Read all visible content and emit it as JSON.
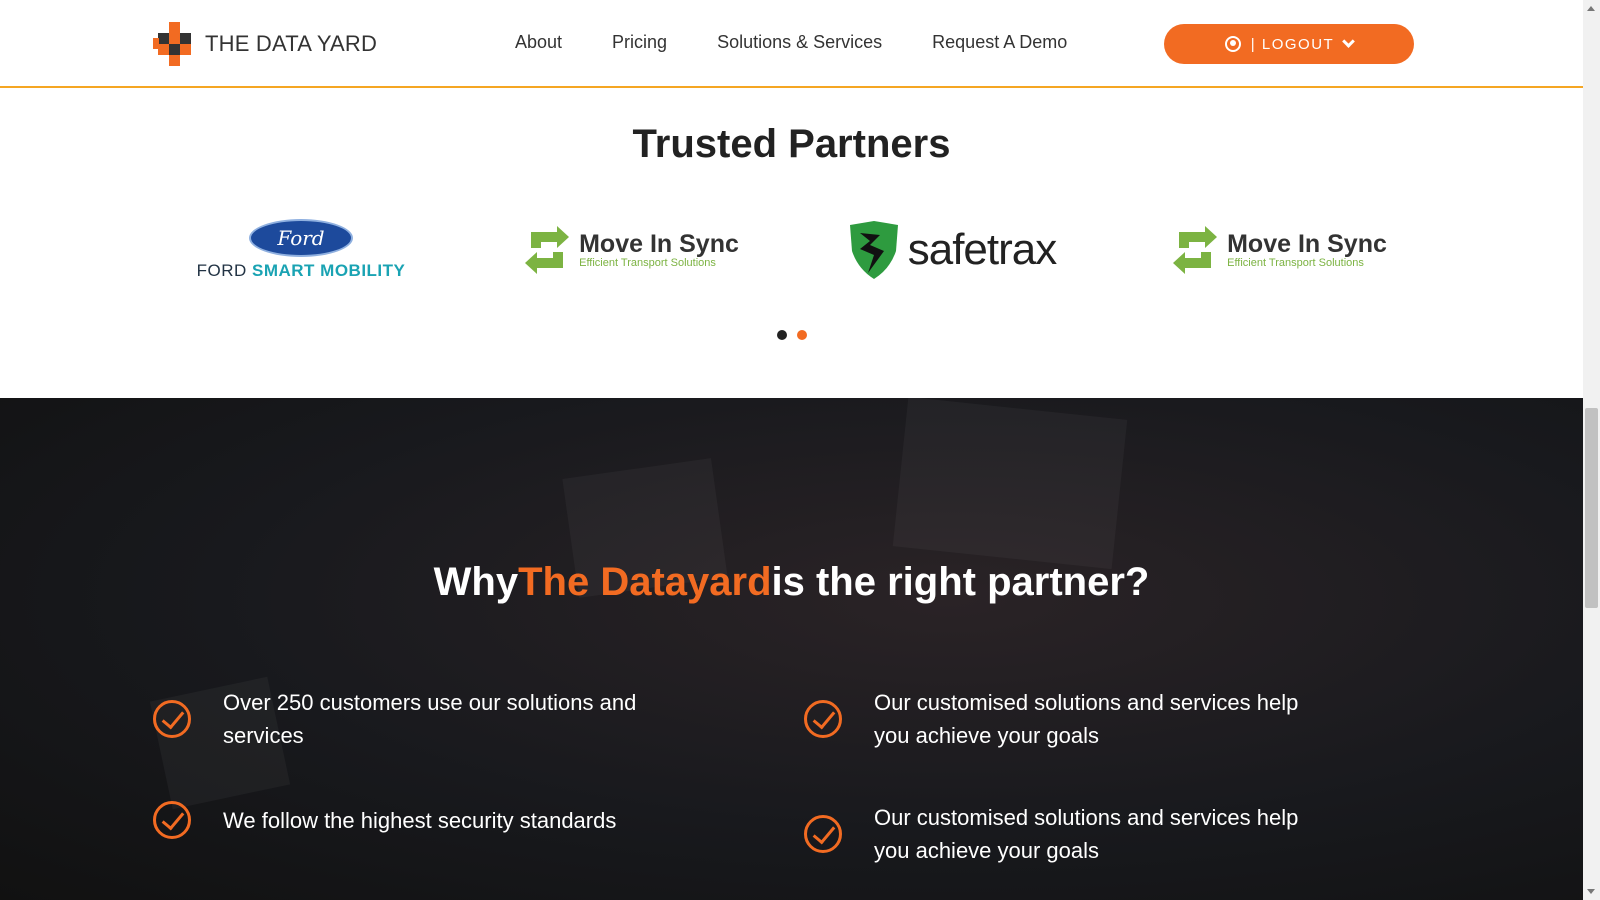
{
  "header": {
    "logo_text": "THE DATA YARD",
    "nav": [
      {
        "label": "About"
      },
      {
        "label": "Pricing"
      },
      {
        "label": "Solutions & Services"
      },
      {
        "label": "Request A Demo"
      }
    ],
    "logout_label": "| LOGOUT"
  },
  "partners": {
    "title": "Trusted Partners",
    "items": [
      {
        "name": "Ford",
        "sub_light": "FORD",
        "sub_bold": "SMART MOBILITY"
      },
      {
        "name": "Move In Sync",
        "tagline": "Efficient Transport Solutions"
      },
      {
        "name": "safetrax"
      },
      {
        "name": "Move In Sync",
        "tagline": "Efficient Transport Solutions"
      }
    ],
    "carousel_active_index": 1
  },
  "why": {
    "title_pre": "Why",
    "title_accent": "The Datayard",
    "title_post": "is the right partner?",
    "features": [
      {
        "text": "Over 250 customers use our solutions and services"
      },
      {
        "text": "Our customised solutions and services help you achieve your goals"
      },
      {
        "text": "We follow the highest security standards"
      },
      {
        "text": "Our customised solutions and services help you achieve your goals"
      }
    ]
  },
  "colors": {
    "accent": "#f26b22",
    "header_border": "#f5a623",
    "dark_bg": "#18191d",
    "ford_blue": "#1d4a9c",
    "ford_teal": "#1aa3b3",
    "mis_green": "#7cb342"
  }
}
